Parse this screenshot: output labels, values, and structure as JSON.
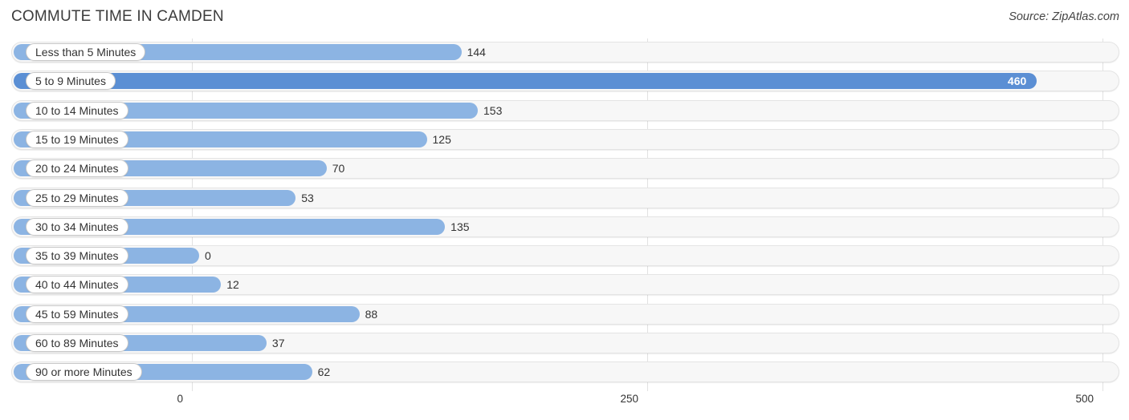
{
  "header": {
    "title": "COMMUTE TIME IN CAMDEN",
    "source": "Source: ZipAtlas.com"
  },
  "colors": {
    "bar": "#8cb4e3",
    "bar_max": "#5b8fd4",
    "track": "#f7f7f7",
    "track_border": "#e4e4e4",
    "gridline": "#e2e2e2",
    "text": "#333333",
    "value_inside": "#ffffff"
  },
  "chart_data": {
    "type": "bar",
    "orientation": "horizontal",
    "title": "COMMUTE TIME IN CAMDEN",
    "xlabel": "",
    "ylabel": "",
    "xlim": [
      0,
      500
    ],
    "grid": true,
    "legend": null,
    "xticks": [
      "0",
      "250",
      "500"
    ],
    "xtick_values": [
      0,
      250,
      500
    ],
    "categories": [
      "Less than 5 Minutes",
      "5 to 9 Minutes",
      "10 to 14 Minutes",
      "15 to 19 Minutes",
      "20 to 24 Minutes",
      "25 to 29 Minutes",
      "30 to 34 Minutes",
      "35 to 39 Minutes",
      "40 to 44 Minutes",
      "45 to 59 Minutes",
      "60 to 89 Minutes",
      "90 or more Minutes"
    ],
    "values": [
      144,
      460,
      153,
      125,
      70,
      53,
      135,
      0,
      12,
      88,
      37,
      62
    ],
    "value_labels": [
      "144",
      "460",
      "153",
      "125",
      "70",
      "53",
      "135",
      "0",
      "12",
      "88",
      "37",
      "62"
    ],
    "max_value": 460,
    "max_category": "5 to 9 Minutes"
  }
}
